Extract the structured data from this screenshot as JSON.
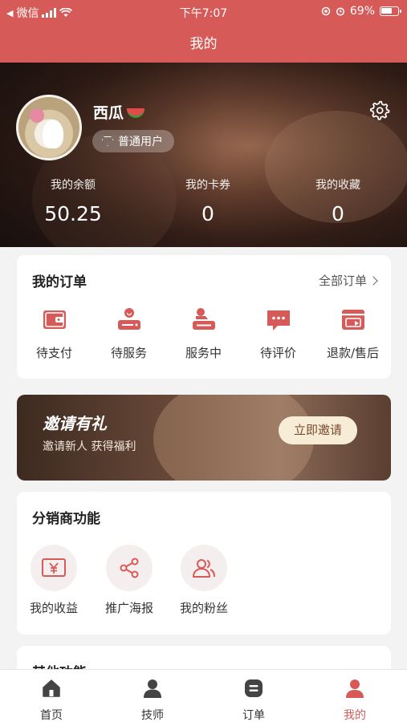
{
  "status": {
    "carrier": "微信",
    "time": "下午7:07",
    "battery": "69%"
  },
  "nav": {
    "title": "我的"
  },
  "profile": {
    "nickname": "西瓜",
    "level": "普通用户"
  },
  "stats": [
    {
      "label": "我的余额",
      "value": "50.25"
    },
    {
      "label": "我的卡券",
      "value": "0"
    },
    {
      "label": "我的收藏",
      "value": "0"
    }
  ],
  "orders": {
    "title": "我的订单",
    "all_label": "全部订单",
    "items": [
      {
        "label": "待支付",
        "icon": "wallet-icon"
      },
      {
        "label": "待服务",
        "icon": "service-pending-icon"
      },
      {
        "label": "服务中",
        "icon": "in-service-icon"
      },
      {
        "label": "待评价",
        "icon": "comment-icon"
      },
      {
        "label": "退款/售后",
        "icon": "refund-icon"
      }
    ]
  },
  "invite": {
    "title": "邀请有礼",
    "subtitle": "邀请新人 获得福利",
    "button": "立即邀请"
  },
  "distributor": {
    "title": "分销商功能",
    "items": [
      {
        "label": "我的收益",
        "icon": "yen-icon"
      },
      {
        "label": "推广海报",
        "icon": "share-icon"
      },
      {
        "label": "我的粉丝",
        "icon": "fans-icon"
      }
    ]
  },
  "other": {
    "title": "其他功能"
  },
  "tabs": [
    {
      "label": "首页",
      "icon": "home-icon"
    },
    {
      "label": "技师",
      "icon": "technician-icon"
    },
    {
      "label": "订单",
      "icon": "order-icon"
    },
    {
      "label": "我的",
      "icon": "user-icon"
    }
  ],
  "colors": {
    "primary": "#d65b58",
    "icon": "#d65b58",
    "invite_button": "#f7ecd6"
  }
}
